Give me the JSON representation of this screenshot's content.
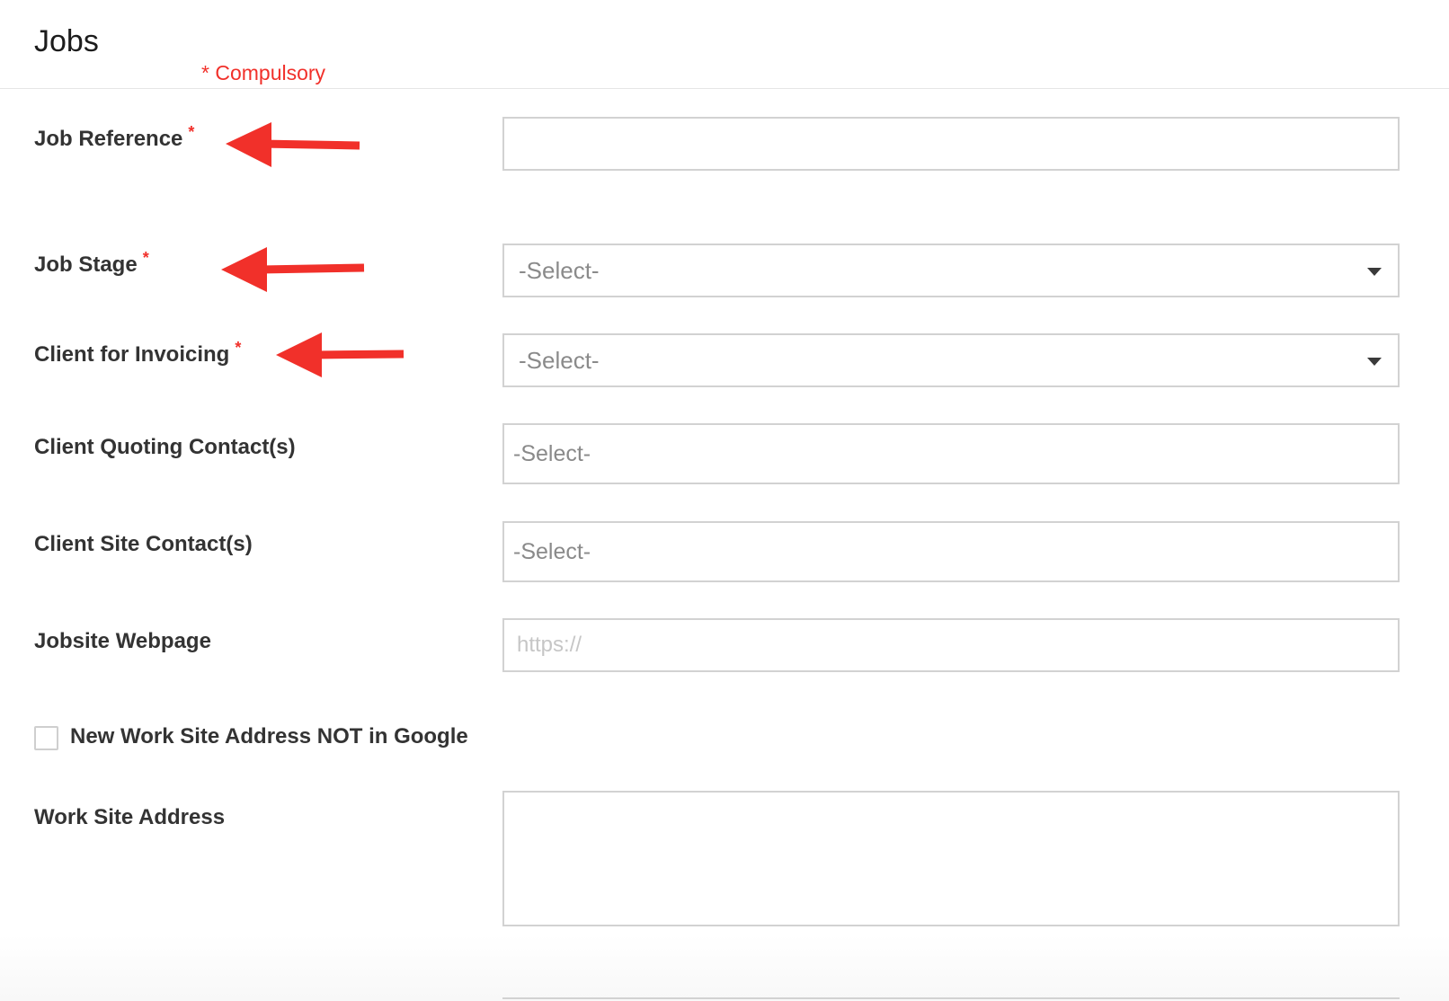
{
  "page": {
    "title": "Jobs",
    "compulsory_note": "* Compulsory"
  },
  "form": {
    "required_mark": "*",
    "job_reference": {
      "label": "Job Reference",
      "value": ""
    },
    "job_stage": {
      "label": "Job Stage",
      "selected": "-Select-"
    },
    "client_for_invoicing": {
      "label": "Client for Invoicing",
      "selected": "-Select-"
    },
    "client_quoting_contacts": {
      "label": "Client Quoting Contact(s)",
      "placeholder": "-Select-"
    },
    "client_site_contacts": {
      "label": "Client Site Contact(s)",
      "placeholder": "-Select-"
    },
    "jobsite_webpage": {
      "label": "Jobsite Webpage",
      "placeholder": "https://",
      "value": ""
    },
    "new_work_site": {
      "label": "New Work Site Address NOT in Google",
      "checked": false
    },
    "work_site_address": {
      "label": "Work Site Address",
      "value": ""
    }
  },
  "annotations": {
    "arrow_color": "#f1302a",
    "arrows_point_to": [
      "Job Reference",
      "Job Stage",
      "Client for Invoicing"
    ]
  }
}
